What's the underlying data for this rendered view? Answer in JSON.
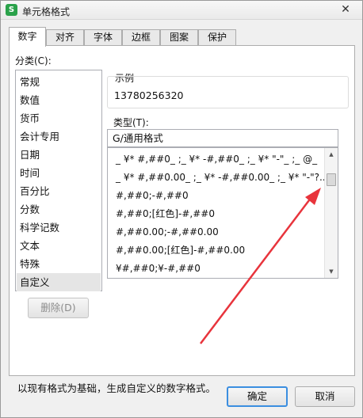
{
  "window": {
    "title": "单元格格式",
    "app_icon": "S",
    "close_glyph": "✕"
  },
  "tabs": [
    "数字",
    "对齐",
    "字体",
    "边框",
    "图案",
    "保护"
  ],
  "category_label": "分类(C):",
  "categories": [
    "常规",
    "数值",
    "货币",
    "会计专用",
    "日期",
    "时间",
    "百分比",
    "分数",
    "科学记数",
    "文本",
    "特殊",
    "自定义"
  ],
  "selected_category": "自定义",
  "sample": {
    "label": "示例",
    "value": "13780256320"
  },
  "type": {
    "label": "类型(T):",
    "value": "G/通用格式",
    "formats": [
      "_ ¥* #,##0_ ;_ ¥* -#,##0_ ;_ ¥* \"-\"_ ;_ @_",
      "_ ¥* #,##0.00_ ;_ ¥* -#,##0.00_ ;_ ¥* \"-\"?...",
      "#,##0;-#,##0",
      "#,##0;[红色]-#,##0",
      "#,##0.00;-#,##0.00",
      "#,##0.00;[红色]-#,##0.00",
      "¥#,##0;¥-#,##0"
    ]
  },
  "delete_label": "删除(D)",
  "description": "以现有格式为基础，生成自定义的数字格式。",
  "buttons": {
    "ok": "确定",
    "cancel": "取消"
  },
  "colors": {
    "annotation_arrow": "#e8343c",
    "default_button_border": "#3b8ee0"
  }
}
